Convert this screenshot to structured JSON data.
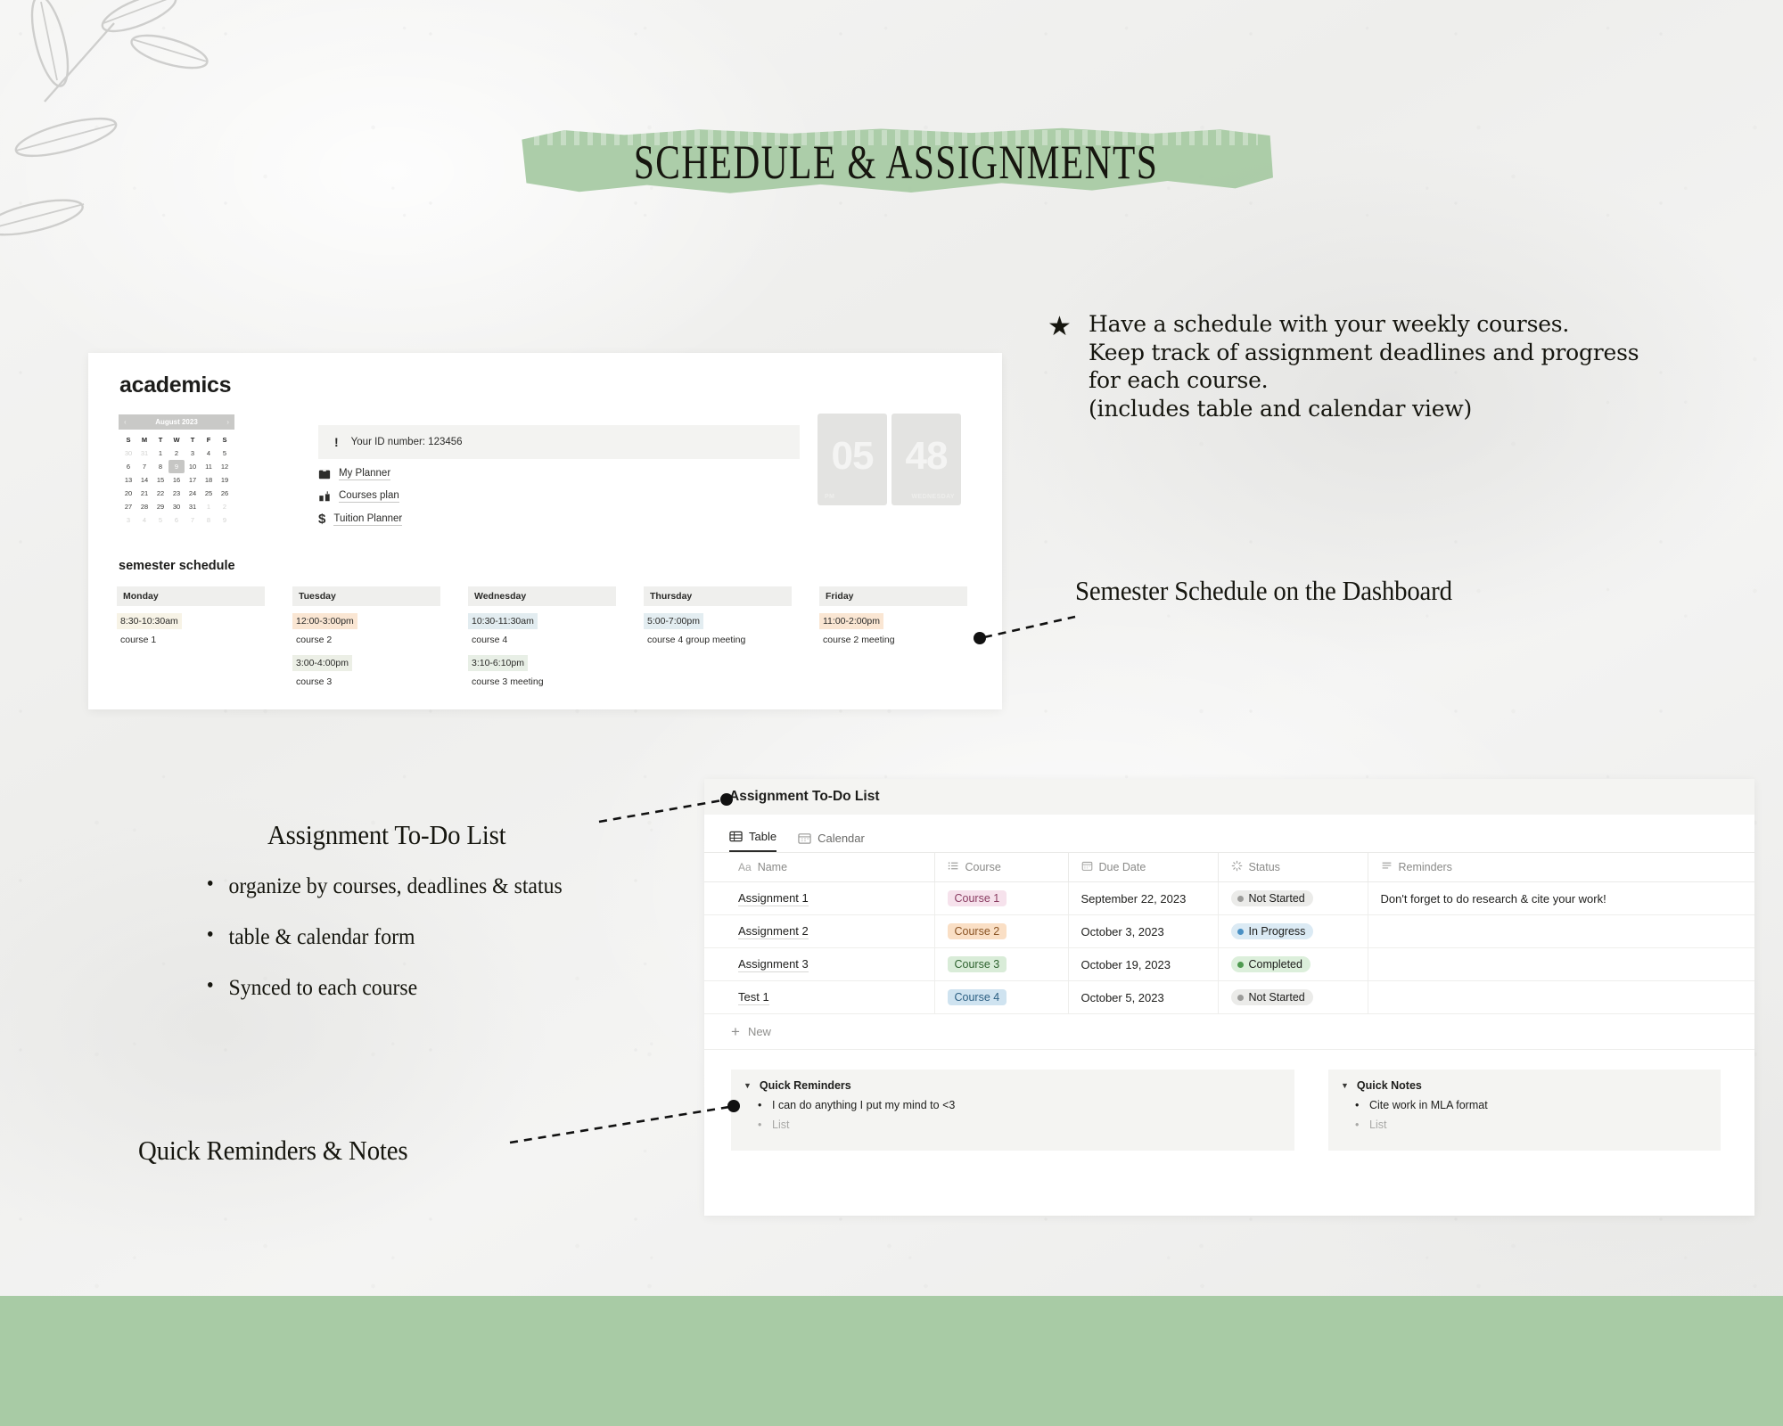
{
  "banner": {
    "title": "SCHEDULE & ASSIGNMENTS",
    "color": "#a8cba5"
  },
  "theme": {
    "band_color": "#a8cba5",
    "page_bg": "#f1f1ef",
    "card_bg": "#ffffff"
  },
  "dashboard": {
    "title": "academics",
    "calendar": {
      "month_label": "August 2023",
      "prev_icon": "chevron-left-icon",
      "next_icon": "chevron-right-icon",
      "dow": [
        "S",
        "M",
        "T",
        "W",
        "T",
        "F",
        "S"
      ],
      "today": 9,
      "weeks": [
        [
          {
            "d": "30",
            "muted": true
          },
          {
            "d": "31",
            "muted": true
          },
          {
            "d": "1"
          },
          {
            "d": "2"
          },
          {
            "d": "3"
          },
          {
            "d": "4"
          },
          {
            "d": "5"
          }
        ],
        [
          {
            "d": "6"
          },
          {
            "d": "7"
          },
          {
            "d": "8"
          },
          {
            "d": "9",
            "today": true
          },
          {
            "d": "10"
          },
          {
            "d": "11"
          },
          {
            "d": "12"
          }
        ],
        [
          {
            "d": "13"
          },
          {
            "d": "14"
          },
          {
            "d": "15"
          },
          {
            "d": "16"
          },
          {
            "d": "17"
          },
          {
            "d": "18"
          },
          {
            "d": "19"
          }
        ],
        [
          {
            "d": "20"
          },
          {
            "d": "21"
          },
          {
            "d": "22"
          },
          {
            "d": "23"
          },
          {
            "d": "24"
          },
          {
            "d": "25"
          },
          {
            "d": "26"
          }
        ],
        [
          {
            "d": "27"
          },
          {
            "d": "28"
          },
          {
            "d": "29"
          },
          {
            "d": "30"
          },
          {
            "d": "31"
          },
          {
            "d": "1",
            "muted": true
          },
          {
            "d": "2",
            "muted": true
          }
        ],
        [
          {
            "d": "3",
            "muted": true
          },
          {
            "d": "4",
            "muted": true
          },
          {
            "d": "5",
            "muted": true
          },
          {
            "d": "6",
            "muted": true
          },
          {
            "d": "7",
            "muted": true
          },
          {
            "d": "8",
            "muted": true
          },
          {
            "d": "9",
            "muted": true
          }
        ]
      ]
    },
    "id_callout": {
      "icon": "exclamation-icon",
      "text": "Your ID number: 123456"
    },
    "links": [
      {
        "icon": "planner-icon",
        "label": "My Planner"
      },
      {
        "icon": "courses-icon",
        "label": "Courses plan"
      },
      {
        "icon": "dollar-icon",
        "label": "Tuition Planner"
      }
    ],
    "clock": {
      "hour": "05",
      "minute": "48",
      "meridiem": "PM",
      "weekday": "WEDNESDAY"
    },
    "semester_schedule": {
      "title": "semester schedule",
      "days": [
        {
          "day": "Monday",
          "entries": [
            {
              "time": "8:30-10:30am",
              "highlight": "#f7f3e6",
              "course": "course 1"
            }
          ]
        },
        {
          "day": "Tuesday",
          "entries": [
            {
              "time": "12:00-3:00pm",
              "highlight": "#fae6d3",
              "course": "course 2"
            },
            {
              "time": "3:00-4:00pm",
              "highlight": "#ecefe6",
              "course": "course 3"
            }
          ]
        },
        {
          "day": "Wednesday",
          "entries": [
            {
              "time": "10:30-11:30am",
              "highlight": "#e2ecf0",
              "course": "course 4"
            },
            {
              "time": "3:10-6:10pm",
              "highlight": "#e8efe6",
              "course": "course 3 meeting"
            }
          ]
        },
        {
          "day": "Thursday",
          "entries": [
            {
              "time": "5:00-7:00pm",
              "highlight": "#e3edf1",
              "course": "course 4 group meeting"
            }
          ]
        },
        {
          "day": "Friday",
          "entries": [
            {
              "time": "11:00-2:00pm",
              "highlight": "#fae6d3",
              "course": "course 2 meeting"
            }
          ]
        }
      ]
    }
  },
  "assignments": {
    "title": "Assignment To-Do List",
    "tabs": [
      {
        "label": "Table",
        "icon": "table-icon",
        "active": true
      },
      {
        "label": "Calendar",
        "icon": "calendar-icon",
        "active": false
      }
    ],
    "columns": [
      {
        "label": "Name",
        "icon": "aa-icon"
      },
      {
        "label": "Course",
        "icon": "select-list-icon"
      },
      {
        "label": "Due Date",
        "icon": "calendar-icon"
      },
      {
        "label": "Status",
        "icon": "status-spinner-icon"
      },
      {
        "label": "Reminders",
        "icon": "text-lines-icon"
      }
    ],
    "rows": [
      {
        "name": "Assignment 1",
        "course": "Course 1",
        "course_bg": "#f6e2ec",
        "course_fg": "#8a3d62",
        "due": "September 22, 2023",
        "status": "Not Started",
        "status_bg": "#ebebe9",
        "status_dot": "#9b9b99",
        "reminder": "Don't forget to do research & cite your work!"
      },
      {
        "name": "Assignment 2",
        "course": "Course 2",
        "course_bg": "#fadfc5",
        "course_fg": "#8a5424",
        "due": "October 3, 2023",
        "status": "In Progress",
        "status_bg": "#dbeaf4",
        "status_dot": "#4a90c4",
        "reminder": ""
      },
      {
        "name": "Assignment 3",
        "course": "Course 3",
        "course_bg": "#d9ecd8",
        "course_fg": "#2f6330",
        "due": "October 19, 2023",
        "status": "Completed",
        "status_bg": "#dcefdb",
        "status_dot": "#4e9a4f",
        "reminder": ""
      },
      {
        "name": "Test 1",
        "course": "Course 4",
        "course_bg": "#cfe3f0",
        "course_fg": "#2d6083",
        "due": "October 5, 2023",
        "status": "Not Started",
        "status_bg": "#ebebe9",
        "status_dot": "#9b9b99",
        "reminder": ""
      }
    ],
    "new_row": {
      "icon": "plus-icon",
      "label": "New"
    },
    "quick_reminders": {
      "title": "Quick Reminders",
      "toggle_icon": "triangle-down-icon",
      "items": [
        {
          "text": "I can do anything I put my mind to <3",
          "placeholder": false
        },
        {
          "text": "List",
          "placeholder": true
        }
      ]
    },
    "quick_notes": {
      "title": "Quick Notes",
      "toggle_icon": "triangle-down-icon",
      "items": [
        {
          "text": "Cite work in MLA format",
          "placeholder": false
        },
        {
          "text": "List",
          "placeholder": true
        }
      ]
    }
  },
  "annotations": {
    "star_icon": "star-icon",
    "star_lines": [
      "Have a schedule with your weekly courses.",
      "Keep track of assignment deadlines and progress",
      "for each course.",
      "(includes table and calendar view)"
    ],
    "semester_label": "Semester Schedule on the Dashboard",
    "todo_label": "Assignment To-Do List",
    "todo_bullets": [
      "organize by courses, deadlines & status",
      "table & calendar form",
      "Synced to each course"
    ],
    "quick_label": "Quick Reminders & Notes"
  }
}
